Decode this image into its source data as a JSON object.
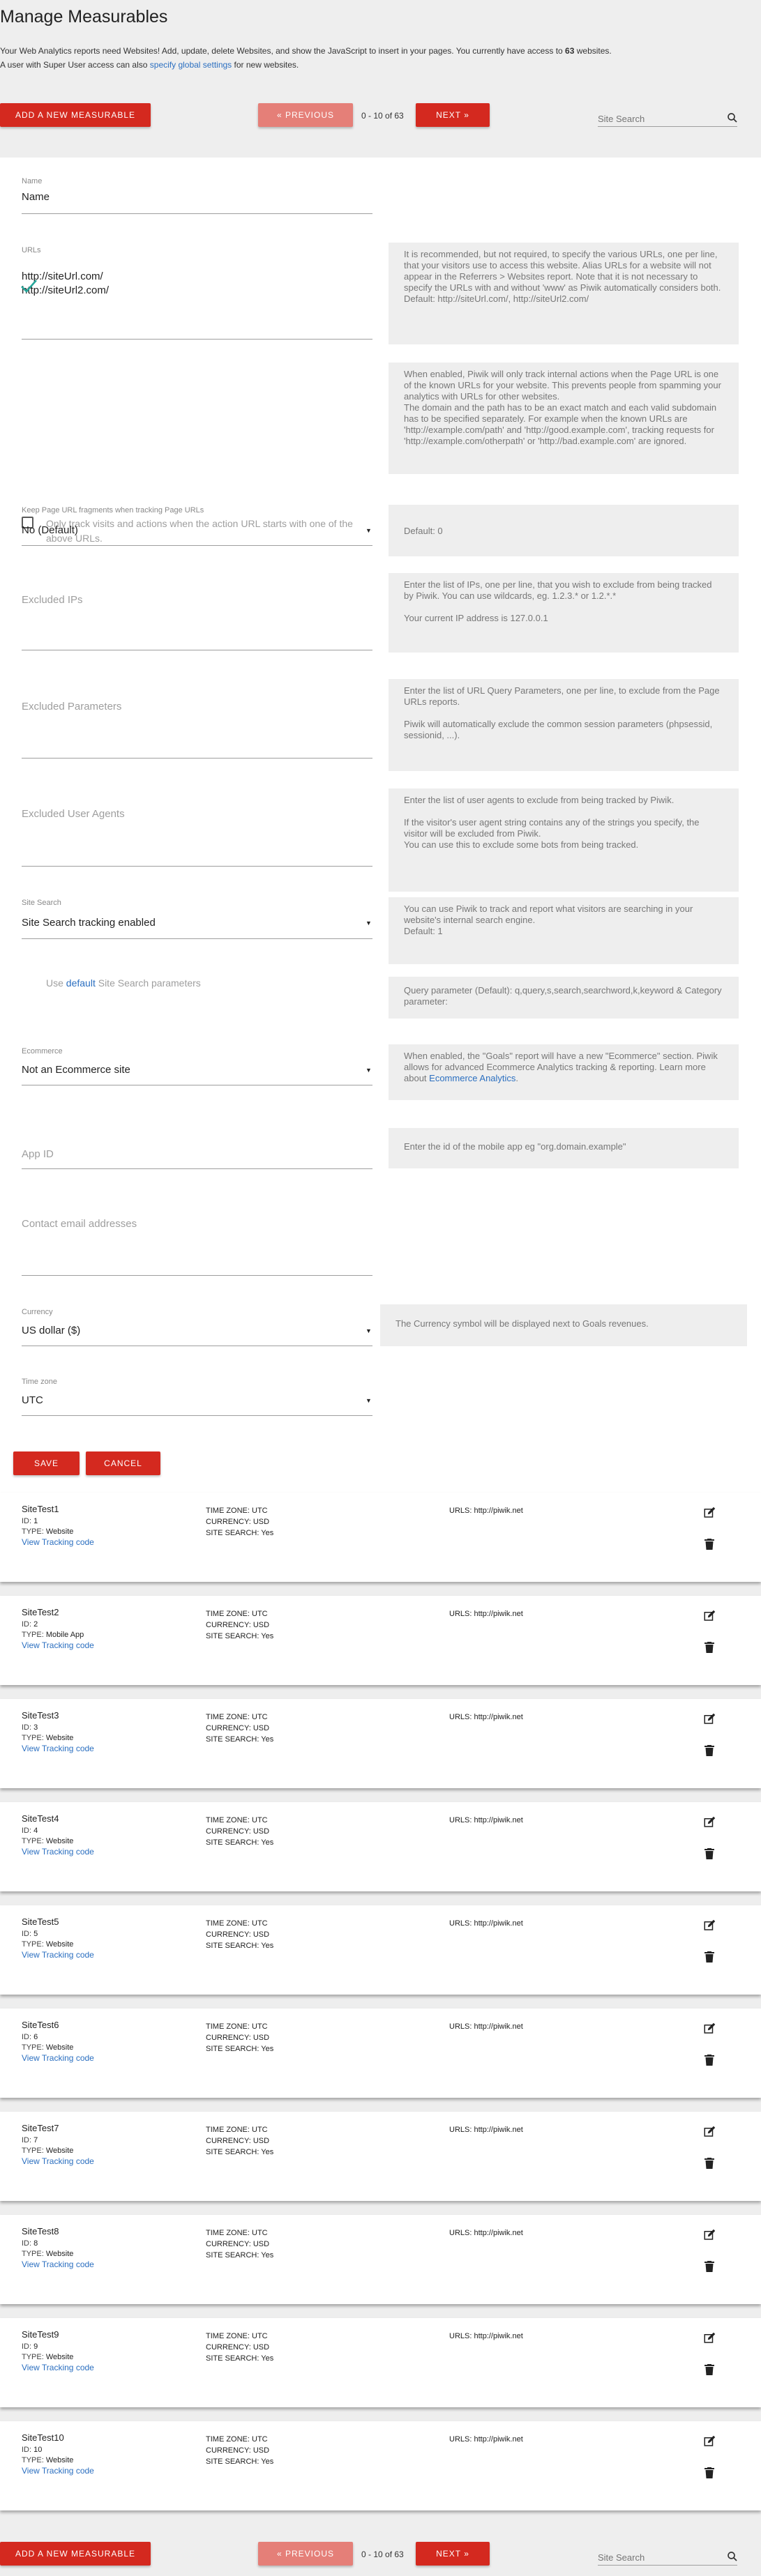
{
  "page": {
    "title": "Manage Measurables",
    "intro_line1_a": "Your Web Analytics reports need Websites! Add, update, delete Websites, and show the JavaScript to insert in your pages. You currently have access to ",
    "intro_count": "63",
    "intro_line1_b": " websites.",
    "intro_line2_a": "A user with Super User access can also ",
    "intro_link": "specify global settings",
    "intro_line2_b": " for new websites."
  },
  "toolbar": {
    "add_label": "ADD A NEW MEASURABLE",
    "prev_label": "« PREVIOUS",
    "pager_text": "0 - 10 of 63",
    "next_label": "NEXT »",
    "search_placeholder": "Site Search"
  },
  "form": {
    "name_label": "Name",
    "name_value": "Name",
    "urls_label": "URLs",
    "urls_line1": "http://siteUrl.com/",
    "urls_line2": "http://siteUrl2.com/",
    "urls_help": "It is recommended, but not required, to specify the various URLs, one per line, that your visitors use to access this website. Alias URLs for a website will not appear in the Referrers > Websites report. Note that it is not necessary to specify the URLs with and without 'www' as Piwik automatically considers both.",
    "urls_help_default": "Default: http://siteUrl.com/, http://siteUrl2.com/",
    "only_track_label": "Only track visits and actions when the action URL starts with one of the above URLs.",
    "only_track_help": "When enabled, Piwik will only track internal actions when the Page URL is one of the known URLs for your website. This prevents people from spamming your analytics with URLs for other websites.",
    "only_track_help2": "The domain and the path has to be an exact match and each valid subdomain has to be specified separately. For example when the known URLs are 'http://example.com/path' and 'http://good.example.com', tracking requests for 'http://example.com/otherpath' or 'http://bad.example.com' are ignored.",
    "fragments_label": "Keep Page URL fragments when tracking Page URLs",
    "fragments_value": "No (Default)",
    "fragments_help": "Default: 0",
    "excluded_ips_label": "Excluded IPs",
    "excluded_ips_help": "Enter the list of IPs, one per line, that you wish to exclude from being tracked by Piwik. You can use wildcards, eg. 1.2.3.* or 1.2.*.*",
    "excluded_ips_help2": "Your current IP address is 127.0.0.1",
    "excluded_params_label": "Excluded Parameters",
    "excluded_params_help": "Enter the list of URL Query Parameters, one per line, to exclude from the Page URLs reports.",
    "excluded_params_help2": "Piwik will automatically exclude the common session parameters (phpsessid, sessionid, ...).",
    "excluded_ua_label": "Excluded User Agents",
    "excluded_ua_help": "Enter the list of user agents to exclude from being tracked by Piwik.",
    "excluded_ua_help2": "If the visitor's user agent string contains any of the strings you specify, the visitor will be excluded from Piwik.",
    "excluded_ua_help3": "You can use this to exclude some bots from being tracked.",
    "site_search_label": "Site Search",
    "site_search_value": "Site Search tracking enabled",
    "site_search_help": "You can use Piwik to track and report what visitors are searching in your website's internal search engine.",
    "site_search_help2": "Default: 1",
    "default_params_a": "Use ",
    "default_params_link": "default",
    "default_params_b": " Site Search parameters",
    "default_params_help": "Query parameter (Default): q,query,s,search,searchword,k,keyword & Category parameter:",
    "ecommerce_label": "Ecommerce",
    "ecommerce_value": "Not an Ecommerce site",
    "ecommerce_help": "When enabled, the \"Goals\" report will have a new \"Ecommerce\" section. Piwik allows for advanced Ecommerce Analytics tracking & reporting. Learn more about ",
    "ecommerce_help_link": "Ecommerce Analytics",
    "ecommerce_help_end": ".",
    "app_id_label": "App ID",
    "app_id_help": "Enter the id of the mobile app eg \"org.domain.example\"",
    "contact_label": "Contact email addresses",
    "currency_label": "Currency",
    "currency_value": "US dollar ($)",
    "currency_help": "The Currency symbol will be displayed next to Goals revenues.",
    "timezone_label": "Time zone",
    "timezone_value": "UTC",
    "save_label": "SAVE",
    "cancel_label": "CANCEL"
  },
  "site_labels": {
    "id": "ID:",
    "type": "TYPE:",
    "track": "View Tracking code",
    "timezone": "TIME ZONE:",
    "currency": "CURRENCY:",
    "sitesearch": "SITE SEARCH:",
    "urls": "URLS:"
  },
  "sites": [
    {
      "name": "SiteTest1",
      "id": "1",
      "type": "Website",
      "timezone": "UTC",
      "currency": "USD",
      "sitesearch": "Yes",
      "urls": "http://piwik.net"
    },
    {
      "name": "SiteTest2",
      "id": "2",
      "type": "Mobile App",
      "timezone": "UTC",
      "currency": "USD",
      "sitesearch": "Yes",
      "urls": "http://piwik.net"
    },
    {
      "name": "SiteTest3",
      "id": "3",
      "type": "Website",
      "timezone": "UTC",
      "currency": "USD",
      "sitesearch": "Yes",
      "urls": "http://piwik.net"
    },
    {
      "name": "SiteTest4",
      "id": "4",
      "type": "Website",
      "timezone": "UTC",
      "currency": "USD",
      "sitesearch": "Yes",
      "urls": "http://piwik.net"
    },
    {
      "name": "SiteTest5",
      "id": "5",
      "type": "Website",
      "timezone": "UTC",
      "currency": "USD",
      "sitesearch": "Yes",
      "urls": "http://piwik.net"
    },
    {
      "name": "SiteTest6",
      "id": "6",
      "type": "Website",
      "timezone": "UTC",
      "currency": "USD",
      "sitesearch": "Yes",
      "urls": "http://piwik.net"
    },
    {
      "name": "SiteTest7",
      "id": "7",
      "type": "Website",
      "timezone": "UTC",
      "currency": "USD",
      "sitesearch": "Yes",
      "urls": "http://piwik.net"
    },
    {
      "name": "SiteTest8",
      "id": "8",
      "type": "Website",
      "timezone": "UTC",
      "currency": "USD",
      "sitesearch": "Yes",
      "urls": "http://piwik.net"
    },
    {
      "name": "SiteTest9",
      "id": "9",
      "type": "Website",
      "timezone": "UTC",
      "currency": "USD",
      "sitesearch": "Yes",
      "urls": "http://piwik.net"
    },
    {
      "name": "SiteTest10",
      "id": "10",
      "type": "Website",
      "timezone": "UTC",
      "currency": "USD",
      "sitesearch": "Yes",
      "urls": "http://piwik.net"
    }
  ],
  "icons": {
    "search": "search-icon",
    "edit": "edit-icon",
    "delete": "trash-icon",
    "check": "checkmark-icon",
    "dropdown": "caret-down-icon"
  },
  "colors": {
    "accent": "#d4291f",
    "accent_disabled": "#e57f78",
    "link": "#2b6fc0",
    "check": "#26a69a",
    "background": "#eeeeee"
  }
}
